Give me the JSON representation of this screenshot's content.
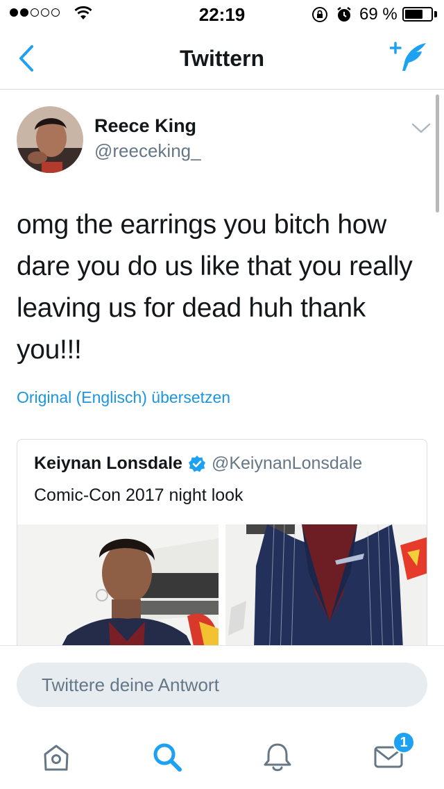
{
  "status_bar": {
    "time": "22:19",
    "battery_percent": "69 %",
    "battery_level": 0.69,
    "signal_bars_filled": 2,
    "signal_bars_total": 5
  },
  "nav": {
    "title": "Twittern",
    "back_icon": "chevron-left-icon",
    "compose_icon": "compose-tweet-icon"
  },
  "tweet": {
    "author_name": "Reece King",
    "author_handle": "@reeceking_",
    "text": "omg the earrings you bitch how dare you do us like that you really leaving us for dead huh thank you!!!",
    "translate_label": "Original (Englisch) übersetzen"
  },
  "quoted_tweet": {
    "author_name": "Keiynan Lonsdale",
    "author_handle": "@KeiynanLonsdale",
    "verified": true,
    "text": "Comic-Con 2017 night look",
    "photo_count": 2
  },
  "reply": {
    "placeholder": "Twittere deine Antwort"
  },
  "tab_bar": {
    "active_tab": "search",
    "messages_badge": "1"
  },
  "colors": {
    "accent": "#1da1f2",
    "link": "#1b95e0",
    "secondary_text": "#657786",
    "primary_text": "#14171a"
  }
}
